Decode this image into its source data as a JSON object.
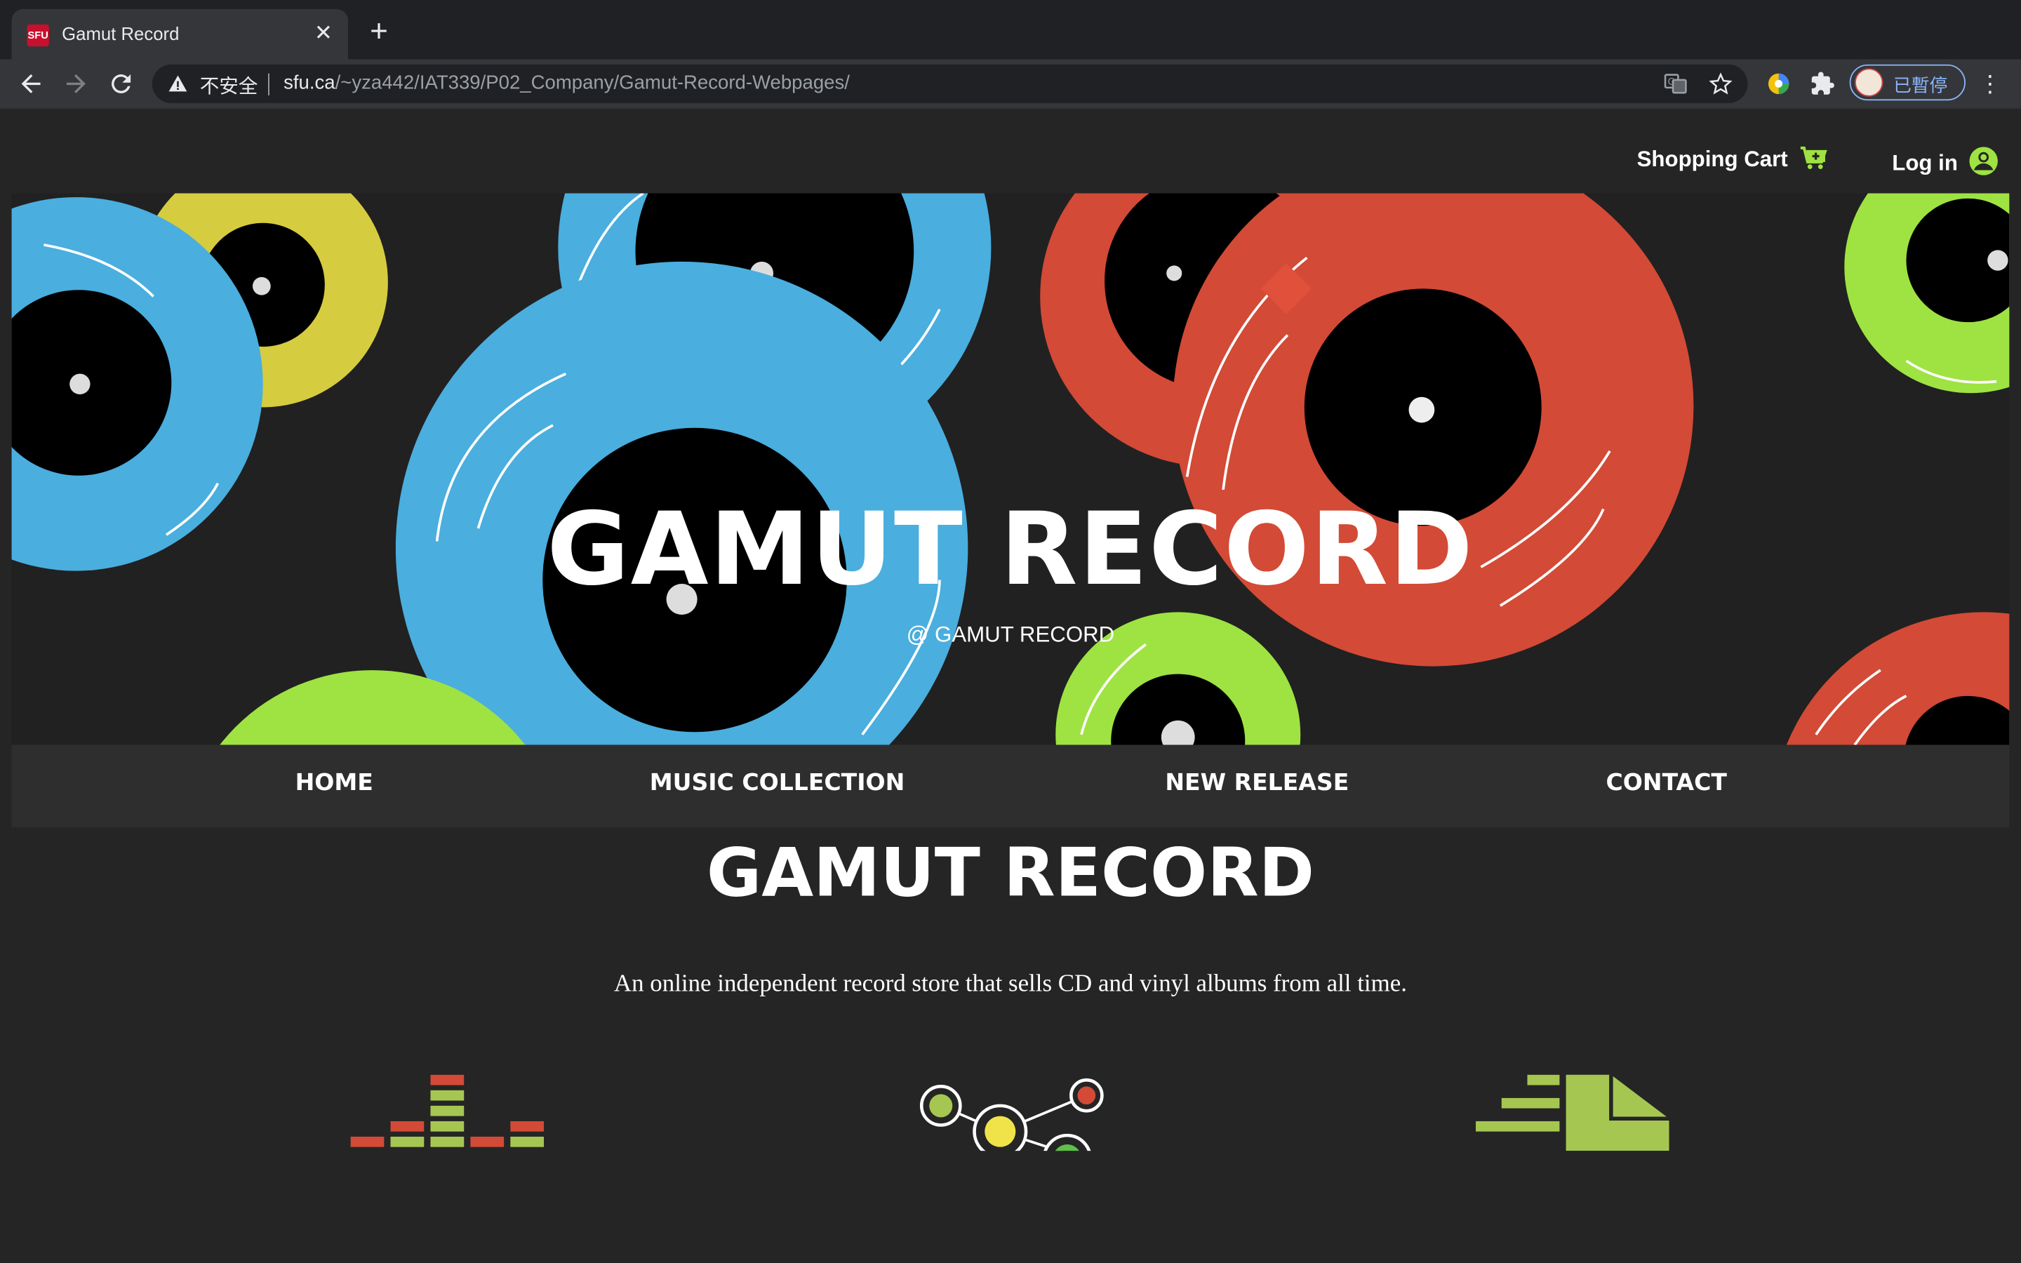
{
  "browser": {
    "tab_title": "Gamut Record",
    "tab_favicon_text": "SFU",
    "security_label": "不安全",
    "url_host": "sfu.ca",
    "url_path": "/~yza442/IAT339/P02_Company/Gamut-Record-Webpages/",
    "profile_label": "已暫停",
    "icons": [
      "back-icon",
      "forward-icon",
      "reload-icon",
      "warning-icon",
      "translate-icon",
      "star-icon",
      "extension-icon",
      "puzzle-icon",
      "menu-icon"
    ]
  },
  "header": {
    "cart_label": "Shopping Cart",
    "login_label": "Log in"
  },
  "hero": {
    "title": "GAMUT RECORD",
    "subtitle": "@ GAMUT RECORD"
  },
  "nav": {
    "items": [
      {
        "label": "HOME"
      },
      {
        "label": "MUSIC COLLECTION"
      },
      {
        "label": "NEW RELEASE"
      },
      {
        "label": "CONTACT"
      }
    ]
  },
  "intro": {
    "title": "GAMUT RECORD",
    "description": "An online independent record store that sells CD and vinyl albums from all time."
  },
  "colors": {
    "page_bg": "#252525",
    "accent_green": "#9ee342",
    "vinyl_blue": "#4aaede",
    "vinyl_red": "#d34a36",
    "vinyl_yellow": "#d6cc3f"
  },
  "feature_icons": [
    "equalizer-icon",
    "network-icon",
    "fast-delivery-icon"
  ]
}
